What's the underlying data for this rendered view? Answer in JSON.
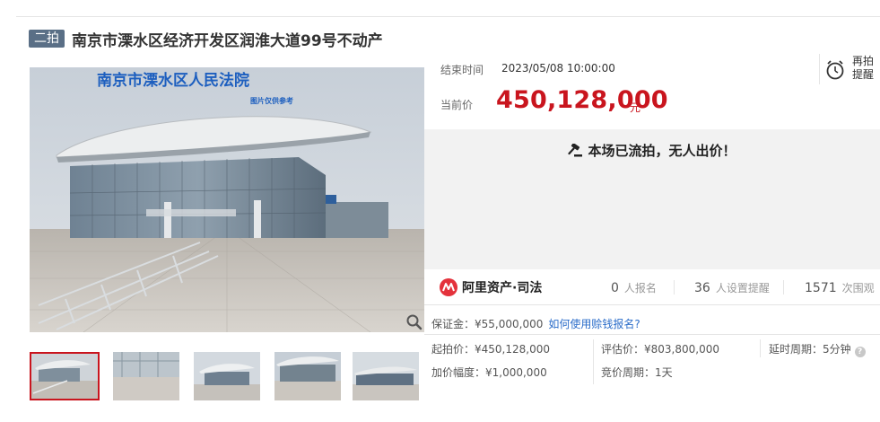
{
  "header": {
    "badge": "二拍",
    "title": "南京市溧水区经济开发区润淮大道99号不动产"
  },
  "gallery": {
    "main_image_sign": "南京市溧水区人民法院",
    "main_image_subsign": "图片仅供参考",
    "zoom_icon": "magnifier-icon",
    "thumbnail_count": 5,
    "active_thumbnail": 1
  },
  "auction": {
    "end_time_label": "结束时间",
    "end_time_value": "2023/05/08 10:00:00",
    "current_price_label": "当前价",
    "current_price_value": "450,128,000",
    "currency_unit": "元",
    "remind_label_line1": "再拍",
    "remind_label_line2": "提醒",
    "remind_icon": "alarm-clock-icon",
    "status_text": "本场已流拍，无人出价！",
    "status_icon": "gavel-icon"
  },
  "stats": {
    "brand": "阿里资产·司法",
    "signups_value": "0",
    "signups_unit": "人报名",
    "reminders_value": "36",
    "reminders_unit": "人设置提醒",
    "views_value": "1571",
    "views_unit": "次围观"
  },
  "terms": {
    "deposit": "保证金：¥55,000,000",
    "deposit_link": "如何使用赊钱报名?",
    "start_price": "起拍价：¥450,128,000",
    "appraisal": "评估价：¥803,800,000",
    "extension": "延时周期：5分钟",
    "increment": "加价幅度：¥1,000,000",
    "cycle": "竞价周期：1天"
  },
  "colors": {
    "price_red": "#c9151e",
    "badge_blue": "#5a6f86",
    "link_blue": "#2a6cc9",
    "panel_gray": "#f2f2f2"
  }
}
